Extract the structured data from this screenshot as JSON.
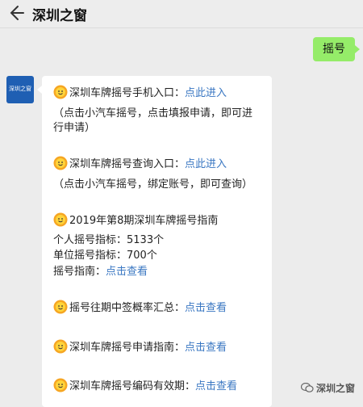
{
  "header": {
    "title": "深圳之窗",
    "back_icon": "back-arrow-icon"
  },
  "outgoing": {
    "text": "摇号"
  },
  "avatar": {
    "text": "深圳之窗",
    "color": "#1f5fb3"
  },
  "message": {
    "items": [
      {
        "prefix": "深圳车牌摇号手机入口：",
        "link": "点此进入"
      },
      {
        "text": "（点击小汽车摇号，点击填报申请，即可进"
      },
      {
        "text": "行申请）"
      },
      {
        "prefix": "深圳车牌摇号查询入口：",
        "link": "点此进入"
      },
      {
        "text": "（点击小汽车摇号，绑定账号，即可查询）"
      },
      {
        "prefix": "2019年第8期深圳车牌摇号指南"
      },
      {
        "text": "个人摇号指标：5133个"
      },
      {
        "text": "单位摇号指标：700个"
      },
      {
        "prefix": "摇号指南：",
        "link": "点击查看"
      },
      {
        "prefix": "摇号往期中签概率汇总：",
        "link": "点击查看"
      },
      {
        "prefix": "深圳车牌摇号申请指南：",
        "link": "点击查看"
      },
      {
        "prefix": "深圳车牌摇号编码有效期：",
        "link": "点击查看"
      }
    ]
  },
  "watermark": {
    "text": "深圳之窗"
  },
  "colors": {
    "link": "#3a77c2",
    "outgoing_bubble": "#95ec69",
    "background": "#ececec"
  }
}
